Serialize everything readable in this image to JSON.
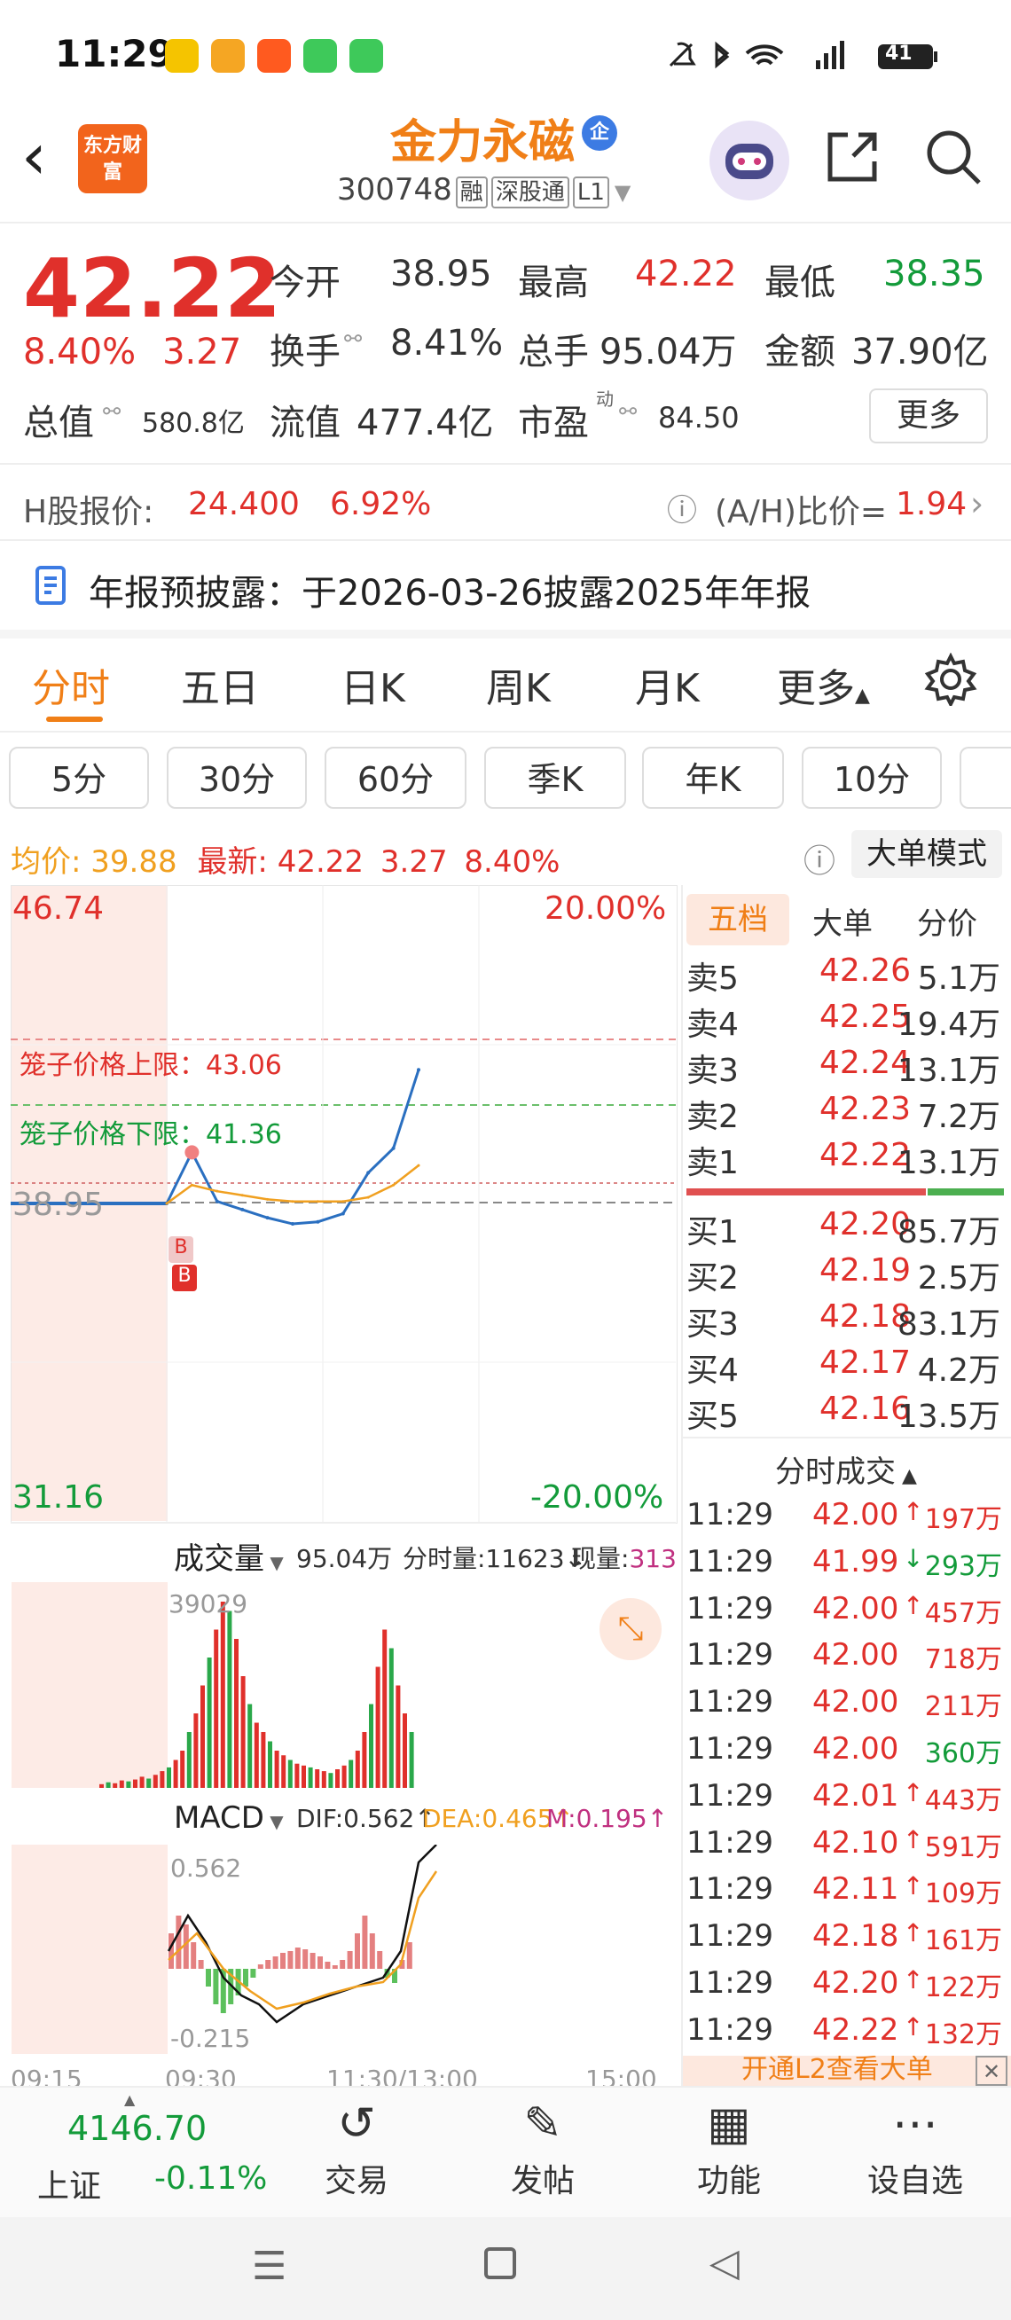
{
  "status_bar": {
    "time": "11:29",
    "battery": "41"
  },
  "header": {
    "logo": "东方财富",
    "stock_name": "金力永磁",
    "code": "300748",
    "tags": [
      "融",
      "深股通",
      "L1"
    ]
  },
  "quote": {
    "price": "42.22",
    "change_pct": "8.40%",
    "change": "3.27",
    "open_label": "今开",
    "open": "38.95",
    "high_label": "最高",
    "high": "42.22",
    "low_label": "最低",
    "low": "38.35",
    "turnover_label": "换手",
    "turnover": "8.41%",
    "volume_label": "总手",
    "volume": "95.04万",
    "amount_label": "金额",
    "amount": "37.90亿",
    "mktcap_label": "总值",
    "mktcap": "580.8亿",
    "float_label": "流值",
    "float": "477.4亿",
    "pe_label": "市盈",
    "pe_sup": "动",
    "pe": "84.50",
    "more": "更多"
  },
  "hshare": {
    "label": "H股报价:",
    "price": "24.400",
    "pct": "6.92%",
    "ratio_label": "(A/H)比价=",
    "ratio": "1.94"
  },
  "notice": "年报预披露：于2026-03-26披露2025年年报",
  "tabs": [
    "分时",
    "五日",
    "日K",
    "周K",
    "月K",
    "更多"
  ],
  "subtabs": [
    "5分",
    "30分",
    "60分",
    "季K",
    "年K",
    "10分"
  ],
  "infobar": {
    "avg_label": "均价:",
    "avg": "39.88",
    "latest_label": "最新:",
    "latest": "42.22",
    "chg": "3.27",
    "pct": "8.40%",
    "mode": "大单模式"
  },
  "chart": {
    "top_price": "46.74",
    "top_pct": "20.00%",
    "bottom_price": "31.16",
    "bottom_pct": "-20.00%",
    "prev_close": "38.95",
    "cage_upper": "笼子价格上限：43.06",
    "cage_lower": "笼子价格下限：41.36",
    "volume_label": "成交量",
    "volume_total": "95.04万",
    "fen_volume": "分时量:11623↓",
    "now_volume_label": "现量:",
    "now_volume": "313",
    "vol_max": "39029",
    "macd_label": "MACD",
    "dif": "DIF:0.562↑",
    "dea": "DEA:0.465↑",
    "m": "M:0.195↑",
    "macd_max": "0.562",
    "macd_min": "-0.215",
    "times": [
      "09:15",
      "09:30",
      "11:30/13:00",
      "15:00"
    ]
  },
  "chart_data": {
    "type": "line",
    "x": [
      "09:30",
      "09:40",
      "09:50",
      "10:00",
      "10:20",
      "10:40",
      "11:00",
      "11:10",
      "11:20",
      "11:25",
      "11:29"
    ],
    "series": [
      {
        "values": [
          38.95,
          40.2,
          39.0,
          38.8,
          38.6,
          38.45,
          38.5,
          38.7,
          39.7,
          40.3,
          42.22
        ]
      },
      {
        "values": [
          38.95,
          39.4,
          39.25,
          39.15,
          39.05,
          39.0,
          39.0,
          39.0,
          39.1,
          39.4,
          39.88
        ]
      }
    ],
    "ylim": [
      31.16,
      46.74
    ]
  },
  "orderbook": {
    "tabs": [
      "五档",
      "大单",
      "分价"
    ],
    "sells": [
      {
        "label": "卖5",
        "price": "42.26",
        "vol": "5.1万"
      },
      {
        "label": "卖4",
        "price": "42.25",
        "vol": "19.4万"
      },
      {
        "label": "卖3",
        "price": "42.24",
        "vol": "13.1万"
      },
      {
        "label": "卖2",
        "price": "42.23",
        "vol": "7.2万"
      },
      {
        "label": "卖1",
        "price": "42.22",
        "vol": "13.1万"
      }
    ],
    "buys": [
      {
        "label": "买1",
        "price": "42.20",
        "vol": "85.7万"
      },
      {
        "label": "买2",
        "price": "42.19",
        "vol": "2.5万"
      },
      {
        "label": "买3",
        "price": "42.18",
        "vol": "83.1万"
      },
      {
        "label": "买4",
        "price": "42.17",
        "vol": "4.2万"
      },
      {
        "label": "买5",
        "price": "42.16",
        "vol": "13.5万"
      }
    ]
  },
  "trades": {
    "title": "分时成交",
    "rows": [
      {
        "t": "11:29",
        "p": "42.00",
        "d": "↑",
        "v": "197万"
      },
      {
        "t": "11:29",
        "p": "41.99",
        "d": "↓",
        "v": "293万"
      },
      {
        "t": "11:29",
        "p": "42.00",
        "d": "↑",
        "v": "457万"
      },
      {
        "t": "11:29",
        "p": "42.00",
        "d": "",
        "v": "718万"
      },
      {
        "t": "11:29",
        "p": "42.00",
        "d": "",
        "v": "211万"
      },
      {
        "t": "11:29",
        "p": "42.00",
        "d": "",
        "v": "360万"
      },
      {
        "t": "11:29",
        "p": "42.01",
        "d": "↑",
        "v": "443万"
      },
      {
        "t": "11:29",
        "p": "42.10",
        "d": "↑",
        "v": "591万"
      },
      {
        "t": "11:29",
        "p": "42.11",
        "d": "↑",
        "v": "109万"
      },
      {
        "t": "11:29",
        "p": "42.18",
        "d": "↑",
        "v": "161万"
      },
      {
        "t": "11:29",
        "p": "42.20",
        "d": "↑",
        "v": "122万"
      },
      {
        "t": "11:29",
        "p": "42.22",
        "d": "↑",
        "v": "132万"
      }
    ],
    "banner": "开通L2查看大单"
  },
  "bottom_nav": {
    "index_value": "4146.70",
    "index_name": "上证",
    "index_pct": "-0.11%",
    "items": [
      "交易",
      "发帖",
      "功能",
      "设自选"
    ]
  }
}
